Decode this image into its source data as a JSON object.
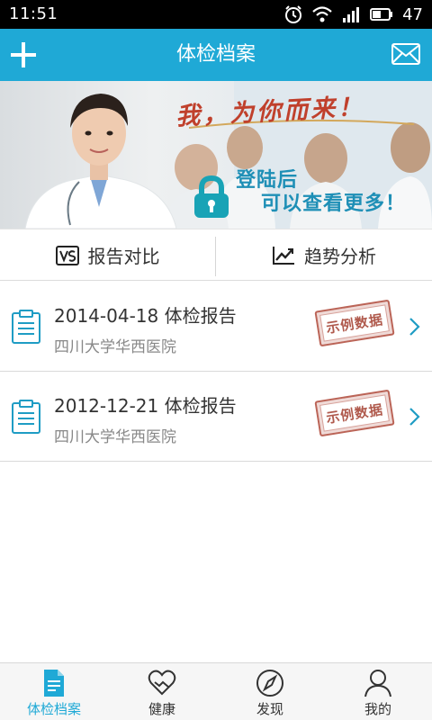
{
  "status_bar": {
    "time": "11:51",
    "battery": "47"
  },
  "header": {
    "title": "体检档案",
    "add_icon": "plus-icon",
    "mail_icon": "mail-icon",
    "accent_color": "#1fa9d6"
  },
  "banner": {
    "slogan": "我，为你而来！",
    "login_line1": "登陆后",
    "login_line2": "可以查看更多！",
    "lock_icon": "lock-icon"
  },
  "actions": {
    "compare": {
      "label": "报告对比",
      "icon": "vs-icon"
    },
    "trend": {
      "label": "趋势分析",
      "icon": "trend-chart-icon"
    }
  },
  "reports": [
    {
      "title": "2014-04-18 体检报告",
      "hospital": "四川大学华西医院",
      "stamp": "示例数据"
    },
    {
      "title": "2012-12-21 体检报告",
      "hospital": "四川大学华西医院",
      "stamp": "示例数据"
    }
  ],
  "nav": [
    {
      "label": "体检档案",
      "icon": "document-icon",
      "active": true
    },
    {
      "label": "健康",
      "icon": "heart-hands-icon",
      "active": false
    },
    {
      "label": "发现",
      "icon": "compass-icon",
      "active": false
    },
    {
      "label": "我的",
      "icon": "user-icon",
      "active": false
    }
  ]
}
